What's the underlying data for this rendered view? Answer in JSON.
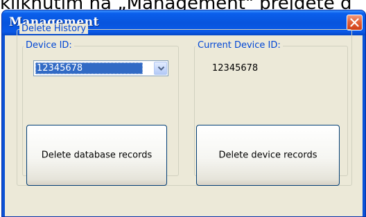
{
  "caption": {
    "partial_text": "kliknutím na „Management\" přejděte d"
  },
  "window": {
    "title": "Management",
    "close_icon": "close-x-icon"
  },
  "delete_history": {
    "legend": "Delete History",
    "device_id": {
      "legend": "Device ID:",
      "selected_value": "12345678",
      "dropdown_icon": "chevron-down-icon"
    },
    "current_device_id": {
      "legend": "Current Device ID:",
      "value": "12345678"
    },
    "buttons": {
      "delete_database_records": "Delete database records",
      "delete_device_records": "Delete device records"
    }
  },
  "colors": {
    "titlebar": "#0855dd",
    "client_bg": "#ece9d8",
    "legend_text": "#0046d5",
    "selection": "#316ac5",
    "close_button": "#e2623a"
  }
}
